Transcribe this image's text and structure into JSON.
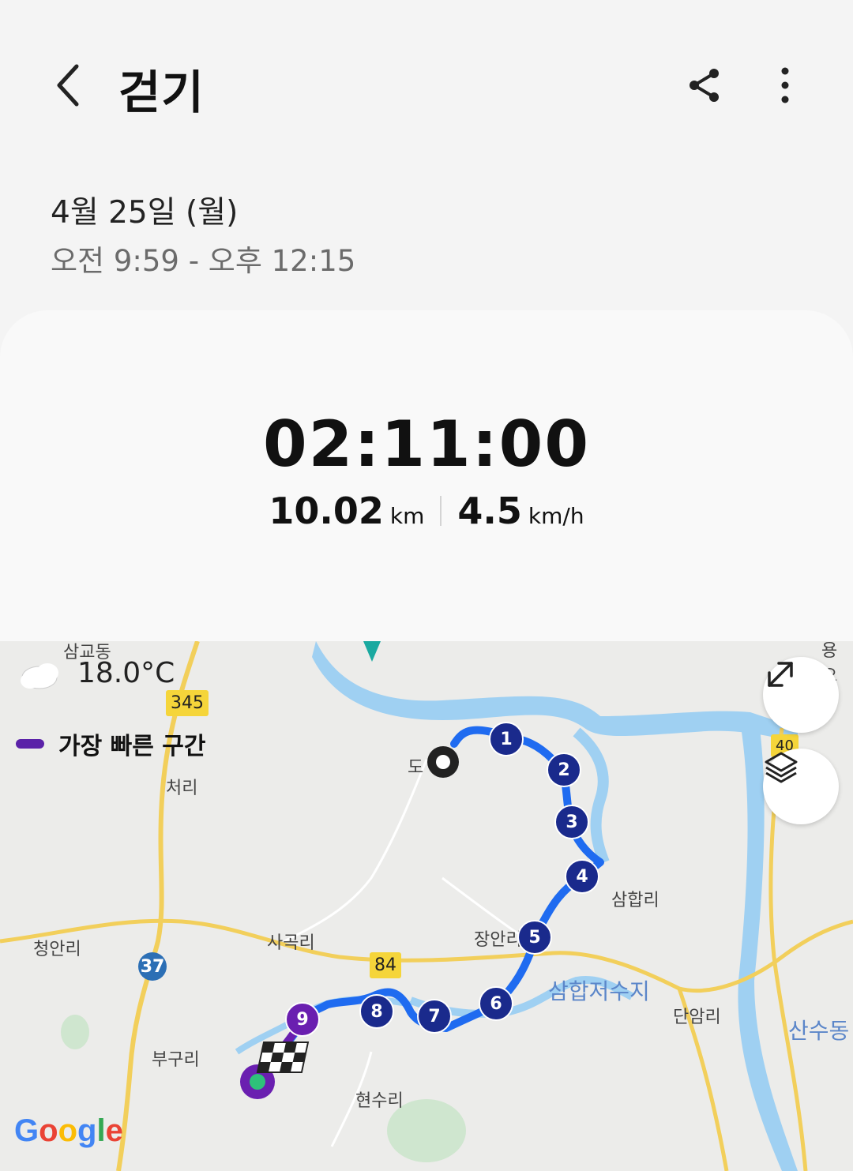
{
  "header": {
    "title": "걷기",
    "back_icon": "chevron-left-icon",
    "share_icon": "share-icon",
    "more_icon": "more-vertical-icon"
  },
  "session": {
    "date": "4월 25일 (월)",
    "time_range": "오전 9:59 - 오후 12:15"
  },
  "summary": {
    "duration": "02:11:00",
    "distance_value": "10.02",
    "distance_unit": "km",
    "speed_value": "4.5",
    "speed_unit": "km/h"
  },
  "map": {
    "temperature": "18.0°C",
    "weather_icon": "cloud-icon",
    "legend_label": "가장 빠른 구간",
    "legend_color": "#5b22a8",
    "route_color": "#1f6bf0",
    "marker_color": "#1a2a8c",
    "fastest_color": "#6a1fb0",
    "places": {
      "samgyodong": "삼교동",
      "cheori": "처리",
      "do": "도",
      "samhapri": "삼합리",
      "jangan": "장안리",
      "sagokri": "사곡리",
      "cheonganri": "청안리",
      "reservoir": "삼합저수지",
      "danamri": "단암리",
      "sansudong": "산수동",
      "buguri": "부구리",
      "hyeonsuri": "현수리",
      "top_right": "용오"
    },
    "roads": {
      "r345": "345",
      "r84": "84",
      "r37": "37",
      "r40": "40"
    },
    "markers": [
      "1",
      "2",
      "3",
      "4",
      "5",
      "6",
      "7",
      "8",
      "9"
    ],
    "expand_icon": "expand-icon",
    "layers_icon": "layers-icon",
    "attribution": "Google"
  }
}
